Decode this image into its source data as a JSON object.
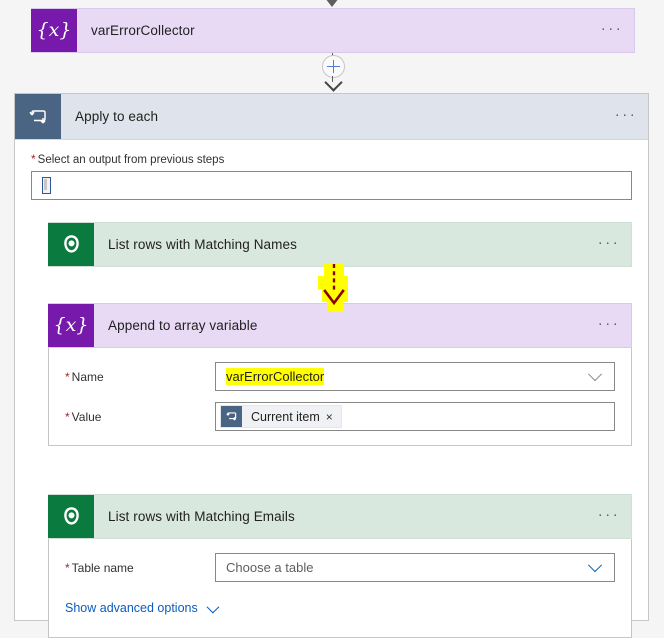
{
  "top_variable_card": {
    "icon": "variable-braces-icon",
    "title": "varErrorCollector",
    "menu": "···",
    "header_color": "#7719aa",
    "body_color": "#e8daf5"
  },
  "add_step_button": {
    "icon": "plus-icon",
    "label": "+"
  },
  "apply_to_each": {
    "icon": "loop-icon",
    "title": "Apply to each",
    "menu": "···",
    "header_color": "#4a6584",
    "input_field": {
      "label": "Select an output from previous steps",
      "required_marker": "*",
      "value": "",
      "token_present": true
    },
    "list_rows_names": {
      "icon": "dataverse-icon",
      "title": "List rows with Matching Names",
      "menu": "···",
      "header_color": "#0b7a3f",
      "body_color": "#d9e8de"
    },
    "info_icon_1": "info-icon",
    "append_to_array": {
      "icon": "variable-braces-icon",
      "title": "Append to array variable",
      "menu": "···",
      "header_color": "#7719aa",
      "body_color": "#e8daf5",
      "fields": [
        {
          "label": "Name",
          "required_marker": "*",
          "value": "varErrorCollector",
          "highlighted": true,
          "control": "dropdown"
        },
        {
          "label": "Value",
          "required_marker": "*",
          "token_label": "Current item",
          "token_remove": "×",
          "control": "token-input"
        }
      ]
    },
    "info_icon_2": "info-icon",
    "list_rows_emails": {
      "icon": "dataverse-icon",
      "title": "List rows with Matching Emails",
      "menu": "···",
      "header_color": "#0b7a3f",
      "body_color": "#d9e8de",
      "fields": [
        {
          "label": "Table name",
          "required_marker": "*",
          "placeholder": "Choose a table",
          "control": "dropdown"
        }
      ],
      "advanced_link": "Show advanced options"
    }
  },
  "annotation": {
    "marker_color": "#ffff00",
    "arrow_color": "#8b0000",
    "arrow_style": "dashed-down-arrow"
  }
}
